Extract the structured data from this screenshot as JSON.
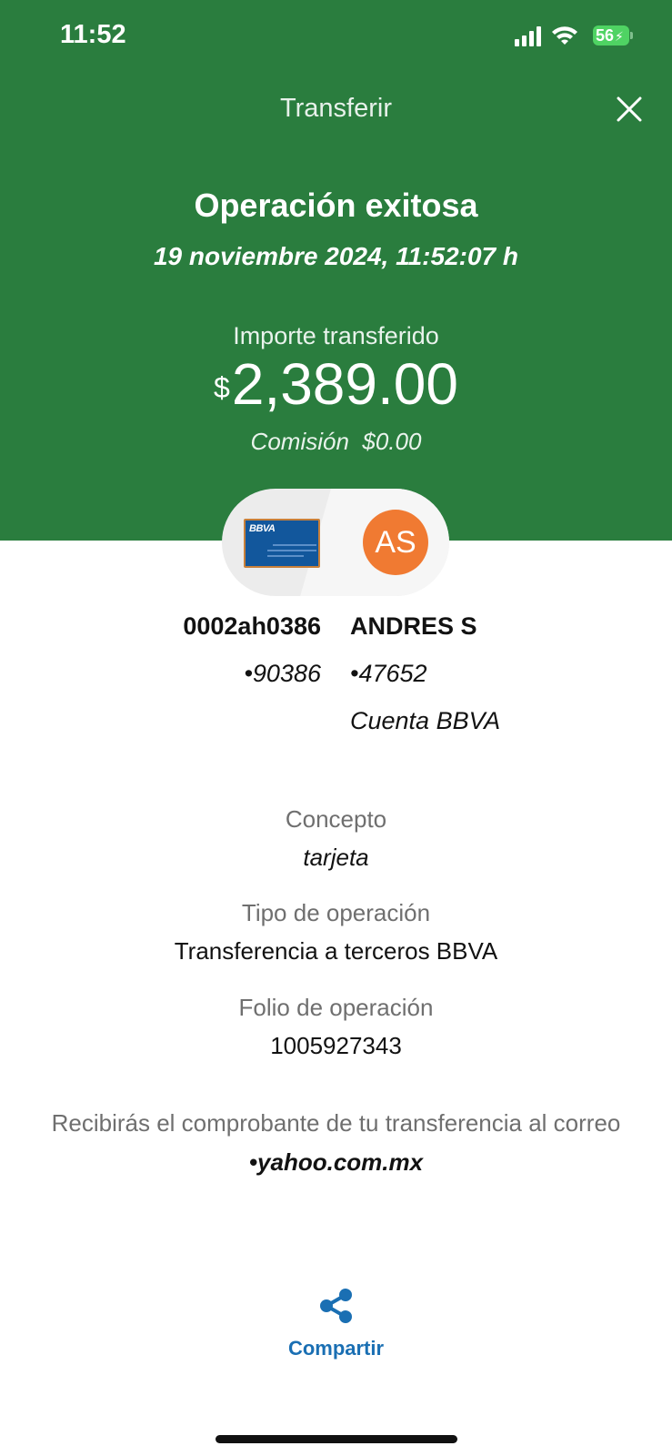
{
  "status_bar": {
    "time": "11:52",
    "battery": "56"
  },
  "header": {
    "title": "Transferir",
    "close_icon": "close-icon"
  },
  "result": {
    "title": "Operación exitosa",
    "datetime": "19 noviembre 2024, 11:52:07 h",
    "amount_label": "Importe transferido",
    "currency_symbol": "$",
    "amount": "2,389.00",
    "commission_label": "Comisión",
    "commission_value": "$0.00"
  },
  "transfer_pair": {
    "source_card_logo": "BBVA",
    "avatar_initials": "AS",
    "avatar_color": "#f07a32"
  },
  "source_account": {
    "name": "0002ah0386",
    "number": "•90386"
  },
  "destination_account": {
    "name": "ANDRES S",
    "number": "•47652",
    "bank": "Cuenta BBVA"
  },
  "details": [
    {
      "label": "Concepto",
      "value": "tarjeta"
    },
    {
      "label": "Tipo de operación",
      "value": "Transferencia a terceros BBVA"
    },
    {
      "label": "Folio de operación",
      "value": "1005927343"
    }
  ],
  "receipt": {
    "message": "Recibirás el comprobante de tu transferencia al correo",
    "email": "•yahoo.com.mx"
  },
  "share": {
    "label": "Compartir",
    "icon": "share-icon"
  },
  "colors": {
    "header_bg": "#2a7d3e",
    "accent_blue": "#1a6fb3",
    "battery_green": "#4fd363"
  }
}
